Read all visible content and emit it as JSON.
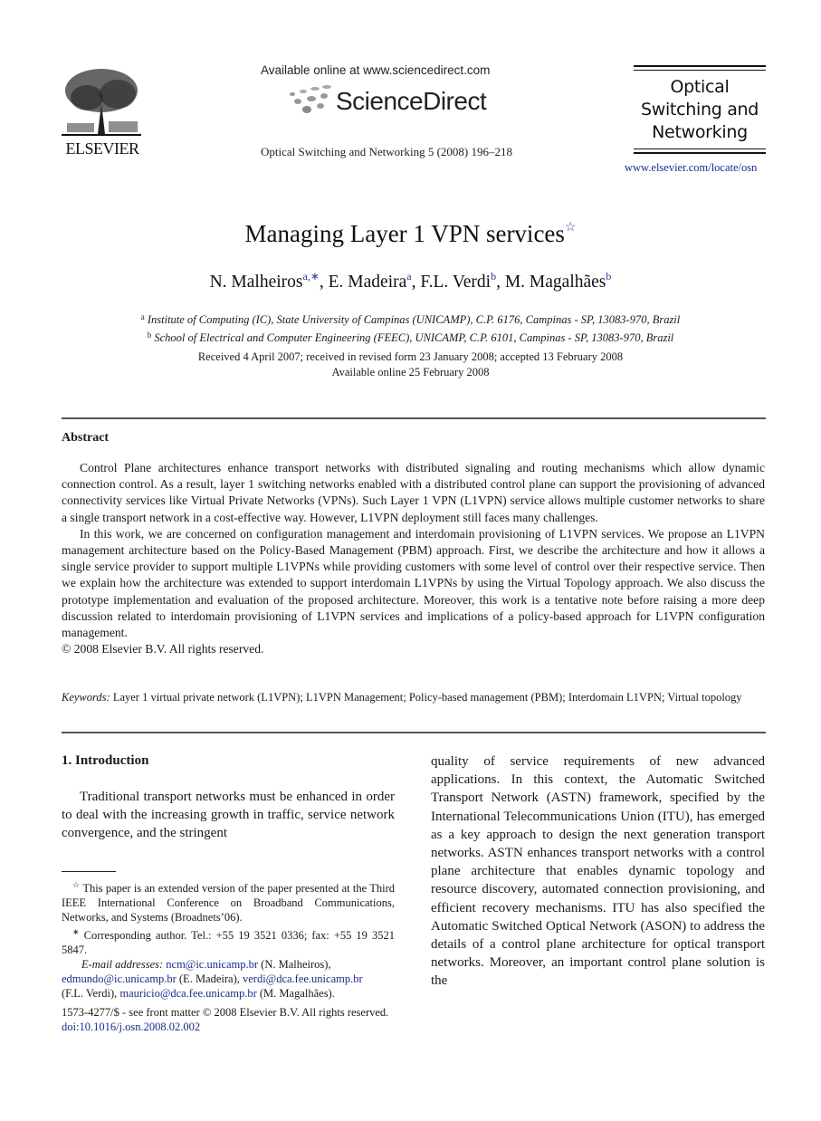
{
  "header": {
    "publisher_name": "ELSEVIER",
    "available_online": "Available online at www.sciencedirect.com",
    "sciencedirect_brand": "ScienceDirect",
    "journal_reference": "Optical Switching and Networking 5 (2008) 196–218",
    "journal_title_lines": [
      "Optical",
      "Switching and",
      "Networking"
    ],
    "journal_url": "www.elsevier.com/locate/osn"
  },
  "article": {
    "title": "Managing Layer 1 VPN services",
    "title_note_mark": "☆",
    "authors": [
      {
        "name": "N. Malheiros",
        "marks": "a,∗",
        "sep": ", "
      },
      {
        "name": "E. Madeira",
        "marks": "a",
        "sep": ", "
      },
      {
        "name": "F.L. Verdi",
        "marks": "b",
        "sep": ", "
      },
      {
        "name": "M. Magalhães",
        "marks": "b",
        "sep": ""
      }
    ],
    "affiliations": [
      {
        "mark": "a",
        "text": "Institute of Computing (IC), State University of Campinas (UNICAMP), C.P. 6176, Campinas - SP, 13083-970, Brazil"
      },
      {
        "mark": "b",
        "text": "School of Electrical and Computer Engineering (FEEC), UNICAMP, C.P. 6101, Campinas - SP, 13083-970, Brazil"
      }
    ],
    "dates": {
      "history": "Received 4 April 2007; received in revised form 23 January 2008; accepted 13 February 2008",
      "online": "Available online 25 February 2008"
    }
  },
  "abstract": {
    "heading": "Abstract",
    "paragraphs": [
      "Control Plane architectures enhance transport networks with distributed signaling and routing mechanisms which allow dynamic connection control. As a result, layer 1 switching networks enabled with a distributed control plane can support the provisioning of advanced connectivity services like Virtual Private Networks (VPNs). Such Layer 1 VPN (L1VPN) service allows multiple customer networks to share a single transport network in a cost-effective way. However, L1VPN deployment still faces many challenges.",
      "In this work, we are concerned on configuration management and interdomain provisioning of L1VPN services. We propose an L1VPN management architecture based on the Policy-Based Management (PBM) approach. First, we describe the architecture and how it allows a single service provider to support multiple L1VPNs while providing customers with some level of control over their respective service. Then we explain how the architecture was extended to support interdomain L1VPNs by using the Virtual Topology approach. We also discuss the prototype implementation and evaluation of the proposed architecture. Moreover, this work is a tentative note before raising a more deep discussion related to interdomain provisioning of L1VPN services and implications of a policy-based approach for L1VPN configuration management."
    ],
    "copyright": "© 2008 Elsevier B.V. All rights reserved."
  },
  "keywords": {
    "label": "Keywords:",
    "text": "Layer 1 virtual private network (L1VPN); L1VPN Management; Policy-based management (PBM); Interdomain L1VPN; Virtual topology"
  },
  "body": {
    "section_heading": "1.  Introduction",
    "left_column": "Traditional transport networks must be enhanced in order to deal with the increasing growth in traffic, service network convergence, and the stringent",
    "right_column": "quality of service requirements of new advanced applications. In this context, the Automatic Switched Transport Network (ASTN) framework, specified by the International Telecommunications Union (ITU), has emerged as a key approach to design the next generation transport networks. ASTN enhances transport networks with a control plane architecture that enables dynamic topology and resource discovery, automated connection provisioning, and efficient recovery mechanisms. ITU has also specified the Automatic Switched Optical Network (ASON) to address the details of a control plane architecture for optical transport networks. Moreover, an important control plane solution is the"
  },
  "footnotes": {
    "note_mark": "☆",
    "note_text": "This paper is an extended version of the paper presented at the Third IEEE International Conference on Broadband Communications, Networks, and Systems (Broadnets’06).",
    "corresponding_mark": "∗",
    "corresponding_text": "Corresponding author. Tel.: +55 19 3521 0336; fax: +55 19 3521 5847.",
    "email_label": "E-mail addresses:",
    "emails": [
      {
        "address": "ncm@ic.unicamp.br",
        "owner": " (N. Malheiros),"
      },
      {
        "address": "edmundo@ic.unicamp.br",
        "owner": " (E. Madeira), "
      },
      {
        "address": "verdi@dca.fee.unicamp.br",
        "owner": " (F.L. Verdi), "
      },
      {
        "address": "mauricio@dca.fee.unicamp.br",
        "owner": " (M. Magalhães)."
      }
    ]
  },
  "front_matter": {
    "issn_line": "1573-4277/$ - see front matter © 2008 Elsevier B.V. All rights reserved.",
    "doi": "doi:10.1016/j.osn.2008.02.002"
  },
  "colors": {
    "link": "#1b2a8a",
    "rule": "#555555",
    "text": "#1a1a1a"
  }
}
